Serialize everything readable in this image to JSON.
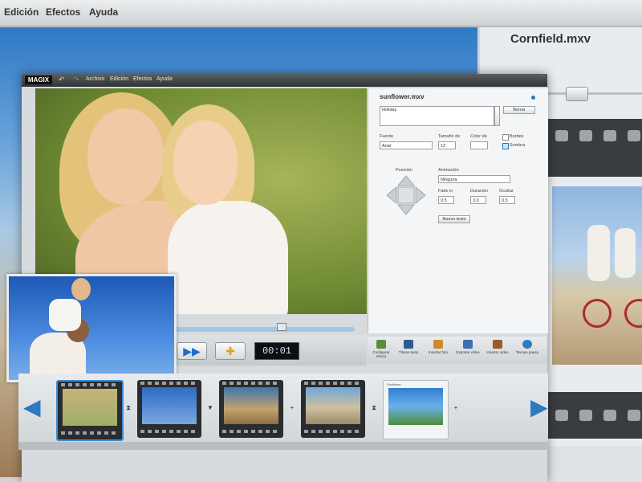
{
  "background_app": {
    "menu": [
      "Edición",
      "Efectos",
      "Ayuda"
    ],
    "title": "Cornfield.mxv"
  },
  "main_window": {
    "logo": "MAGIX",
    "menu": [
      "Archivo",
      "Edición",
      "Efectos",
      "Ayuda"
    ],
    "timecode": "00:01",
    "panel": {
      "file_title": "sunflower.mxv",
      "text_value": "Holiday",
      "delete_button": "Borrar",
      "font_label": "Fuente",
      "font_value": "Arial",
      "size_label": "Tamaño de",
      "size_value": "12",
      "color_label": "Color de",
      "border_label": "Bordes",
      "shadow_label": "Sombra",
      "position_label": "Posición",
      "animation_label": "Animación",
      "animation_value": "Ninguna",
      "fade_in_label": "Fade in",
      "fade_in_value": "0.5",
      "duration_label": "Duración",
      "duration_value": "3.0",
      "hide_label": "Ocultar",
      "hide_value": "0.5",
      "new_text_button": "Nuevo texto"
    },
    "tools": [
      {
        "label": "Configurar efecto",
        "color": "#5a8a3a"
      },
      {
        "label": "Títulos texto",
        "color": "#2f5c8f"
      },
      {
        "label": "Insertar foto",
        "color": "#d08a2a"
      },
      {
        "label": "Exportar vídeo",
        "color": "#3a6fb0"
      },
      {
        "label": "Insertar vídeo",
        "color": "#9a5a2a"
      },
      {
        "label": "Tiempo pausa",
        "color": "#2f7ac0"
      }
    ],
    "timeline_last_clip_label": "Sunflower"
  },
  "colors": {
    "accent": "#2d78be",
    "timecode_bg": "#0e0f10"
  }
}
